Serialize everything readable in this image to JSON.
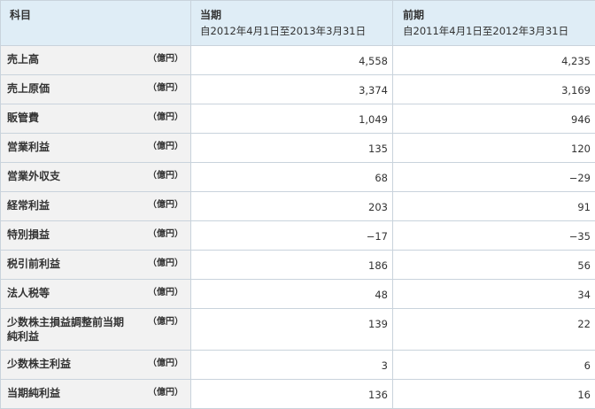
{
  "table": {
    "header": {
      "item": "科目",
      "current": {
        "title": "当期",
        "range": "自2012年4月1日至2013年3月31日"
      },
      "previous": {
        "title": "前期",
        "range": "自2011年4月1日至2012年3月31日"
      }
    },
    "rows": [
      {
        "name": "売上高",
        "unit": "（億円）",
        "current": "4,558",
        "previous": "4,235"
      },
      {
        "name": "売上原価",
        "unit": "（億円）",
        "current": "3,374",
        "previous": "3,169"
      },
      {
        "name": "販管費",
        "unit": "（億円）",
        "current": "1,049",
        "previous": "946"
      },
      {
        "name": "営業利益",
        "unit": "（億円）",
        "current": "135",
        "previous": "120"
      },
      {
        "name": "営業外収支",
        "unit": "（億円）",
        "current": "68",
        "previous": "−29"
      },
      {
        "name": "経常利益",
        "unit": "（億円）",
        "current": "203",
        "previous": "91"
      },
      {
        "name": "特別損益",
        "unit": "（億円）",
        "current": "−17",
        "previous": "−35"
      },
      {
        "name": "税引前利益",
        "unit": "（億円）",
        "current": "186",
        "previous": "56"
      },
      {
        "name": "法人税等",
        "unit": "（億円）",
        "current": "48",
        "previous": "34"
      },
      {
        "name": "少数株主損益調整前当期純利益",
        "unit": "（億円）",
        "current": "139",
        "previous": "22"
      },
      {
        "name": "少数株主利益",
        "unit": "（億円）",
        "current": "3",
        "previous": "6"
      },
      {
        "name": "当期純利益",
        "unit": "（億円）",
        "current": "136",
        "previous": "16"
      }
    ]
  }
}
